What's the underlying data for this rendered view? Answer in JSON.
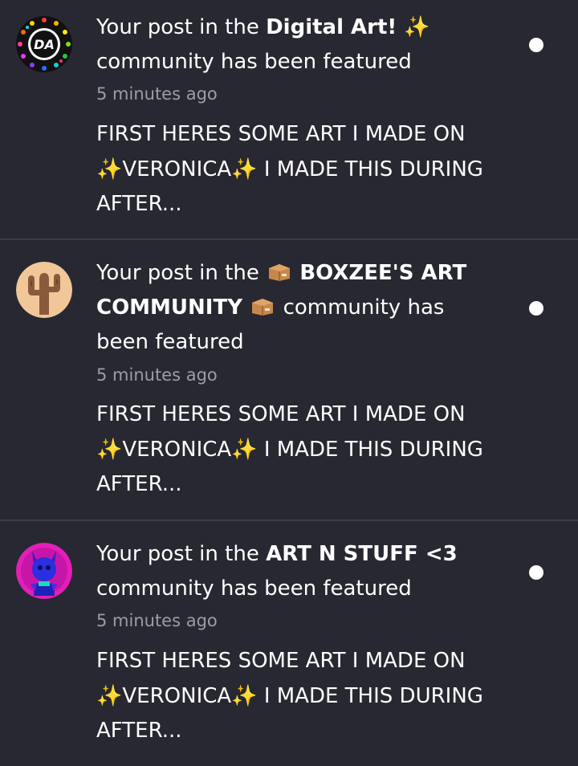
{
  "notifications": [
    {
      "prefix": "Your post in the ",
      "community": "Digital Art! ✨",
      "suffix": " community has been featured",
      "time": "5 minutes ago",
      "preview_line1": "FIRST HERES SOME ART I MADE ON",
      "preview_line2": "✨VERONICA✨ I MADE THIS DURING",
      "preview_line3": "AFTER...",
      "avatar_text": "DA",
      "unread": true
    },
    {
      "prefix": "Your post in the ",
      "community": "BOXZEE'S ART COMMUNITY",
      "suffix": " community has been featured",
      "time": "5 minutes ago",
      "preview_line1": "FIRST HERES SOME ART I MADE ON",
      "preview_line2": "✨VERONICA✨ I MADE THIS DURING",
      "preview_line3": "AFTER...",
      "unread": true
    },
    {
      "prefix": "Your post in the ",
      "community": "ART N STUFF <3",
      "suffix": " community has been featured",
      "time": "5 minutes ago",
      "preview_line1": "FIRST HERES SOME ART I MADE ON",
      "preview_line2": "✨VERONICA✨ I MADE THIS DURING",
      "preview_line3": "AFTER...",
      "unread": true
    }
  ],
  "colors": {
    "background": "#272831",
    "divider": "#3b3c45",
    "timestamp": "#9c9da6",
    "text": "#ffffff"
  }
}
